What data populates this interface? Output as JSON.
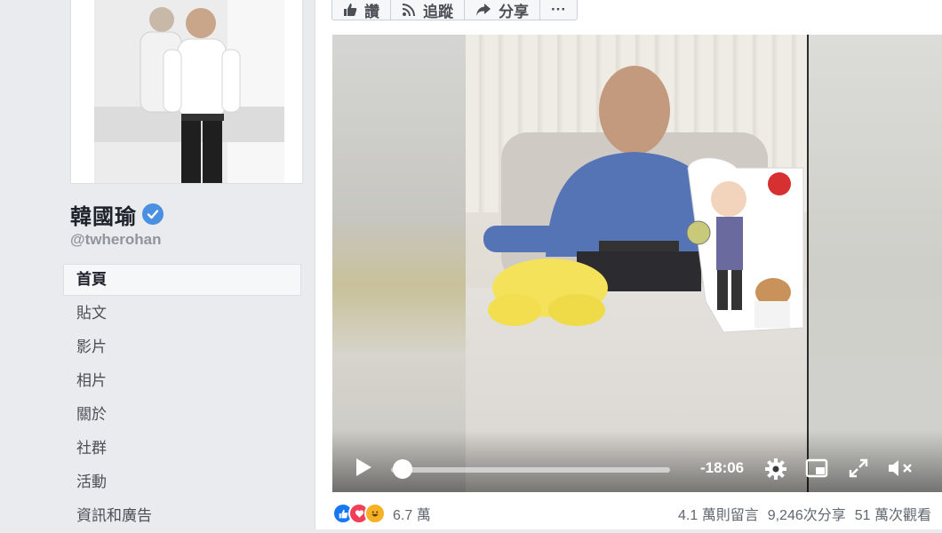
{
  "sidebar": {
    "page_name": "韓國瑜",
    "handle": "@twherohan",
    "items": [
      {
        "label": "首頁",
        "active": true
      },
      {
        "label": "貼文",
        "active": false
      },
      {
        "label": "影片",
        "active": false
      },
      {
        "label": "相片",
        "active": false
      },
      {
        "label": "關於",
        "active": false
      },
      {
        "label": "社群",
        "active": false
      },
      {
        "label": "活動",
        "active": false
      },
      {
        "label": "資訊和廣告",
        "active": false
      }
    ]
  },
  "actions": {
    "like_label": "讚",
    "follow_label": "追蹤",
    "share_label": "分享",
    "more_label": "···"
  },
  "video": {
    "time_remaining": "-18:06",
    "progress": 0.0
  },
  "stats": {
    "reaction_count": "6.7 萬",
    "comments": "4.1 萬則留言",
    "shares": "9,246次分享",
    "views": "51 萬次觀看"
  },
  "colors": {
    "accent": "#4a90e2",
    "like": "#1877f2",
    "love": "#f33e58",
    "haha": "#f7b125"
  }
}
